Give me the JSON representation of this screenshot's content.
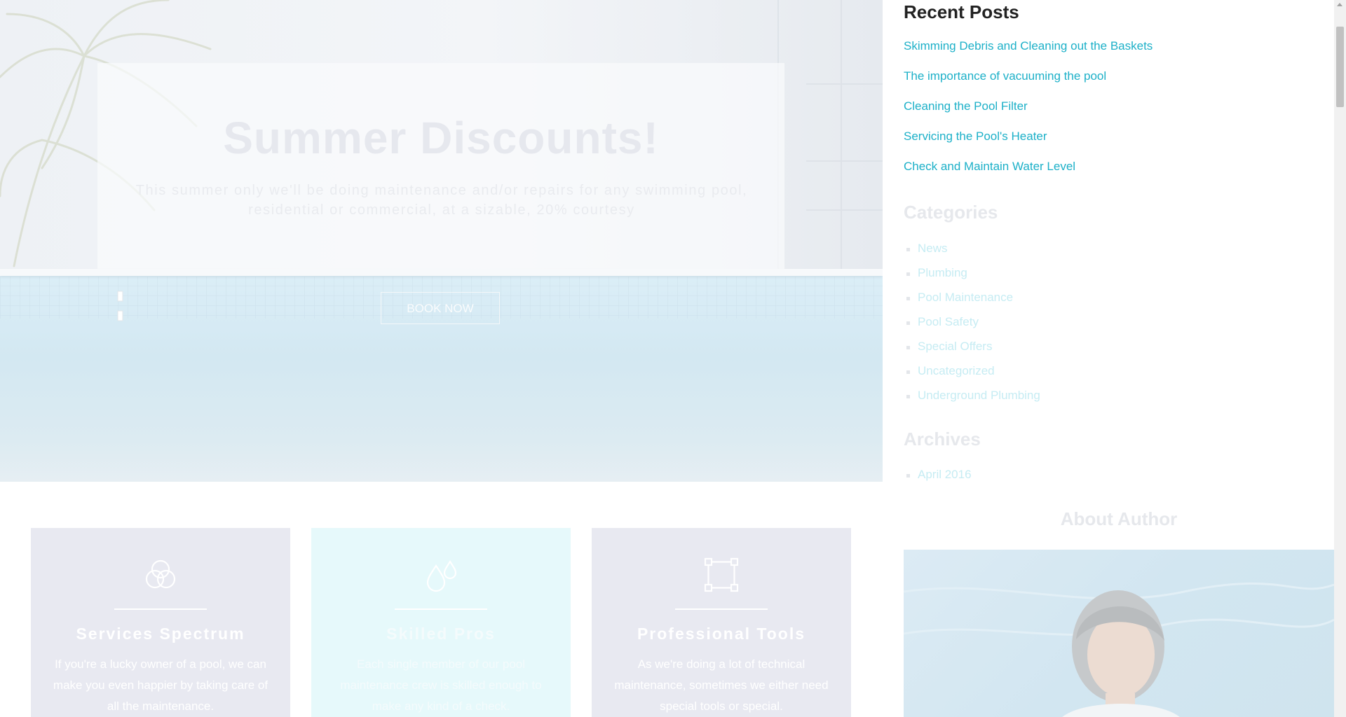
{
  "hero": {
    "title": "Summer Discounts!",
    "subtitle": "This summer only we'll be doing maintenance and/or repairs for any swimming pool, residential or commercial, at a sizable, 20% courtesy",
    "button_label": "BOOK NOW"
  },
  "features": [
    {
      "icon": "circles-icon",
      "title": "Services Spectrum",
      "text": "If you're a lucky owner of a pool, we can make you even happier by taking care of all the maintenance."
    },
    {
      "icon": "water-drops-icon",
      "title": "Skilled Pros",
      "text": "Each single member of our pool maintenance crew is skilled enough to make any kind of a check."
    },
    {
      "icon": "vector-square-icon",
      "title": "Professional Tools",
      "text": "As we're doing a lot of technical maintenance, sometimes we either need special tools or special."
    }
  ],
  "sidebar": {
    "recent_posts": {
      "title": "Recent Posts",
      "items": [
        "Skimming Debris and Cleaning out the Baskets",
        "The importance of vacuuming the pool",
        "Cleaning the Pool Filter",
        "Servicing the Pool's Heater",
        "Check and Maintain Water Level"
      ]
    },
    "categories": {
      "title": "Categories",
      "items": [
        "News",
        "Plumbing",
        "Pool Maintenance",
        "Pool Safety",
        "Special Offers",
        "Uncategorized",
        "Underground Plumbing"
      ]
    },
    "archives": {
      "title": "Archives",
      "items": [
        "April 2016"
      ]
    },
    "about_author": {
      "title": "About Author"
    }
  },
  "colors": {
    "link": "#1cb0c8",
    "heading": "#222222",
    "feature_card": "#e8e9f1",
    "feature_card_highlight": "#e6f9fb"
  }
}
